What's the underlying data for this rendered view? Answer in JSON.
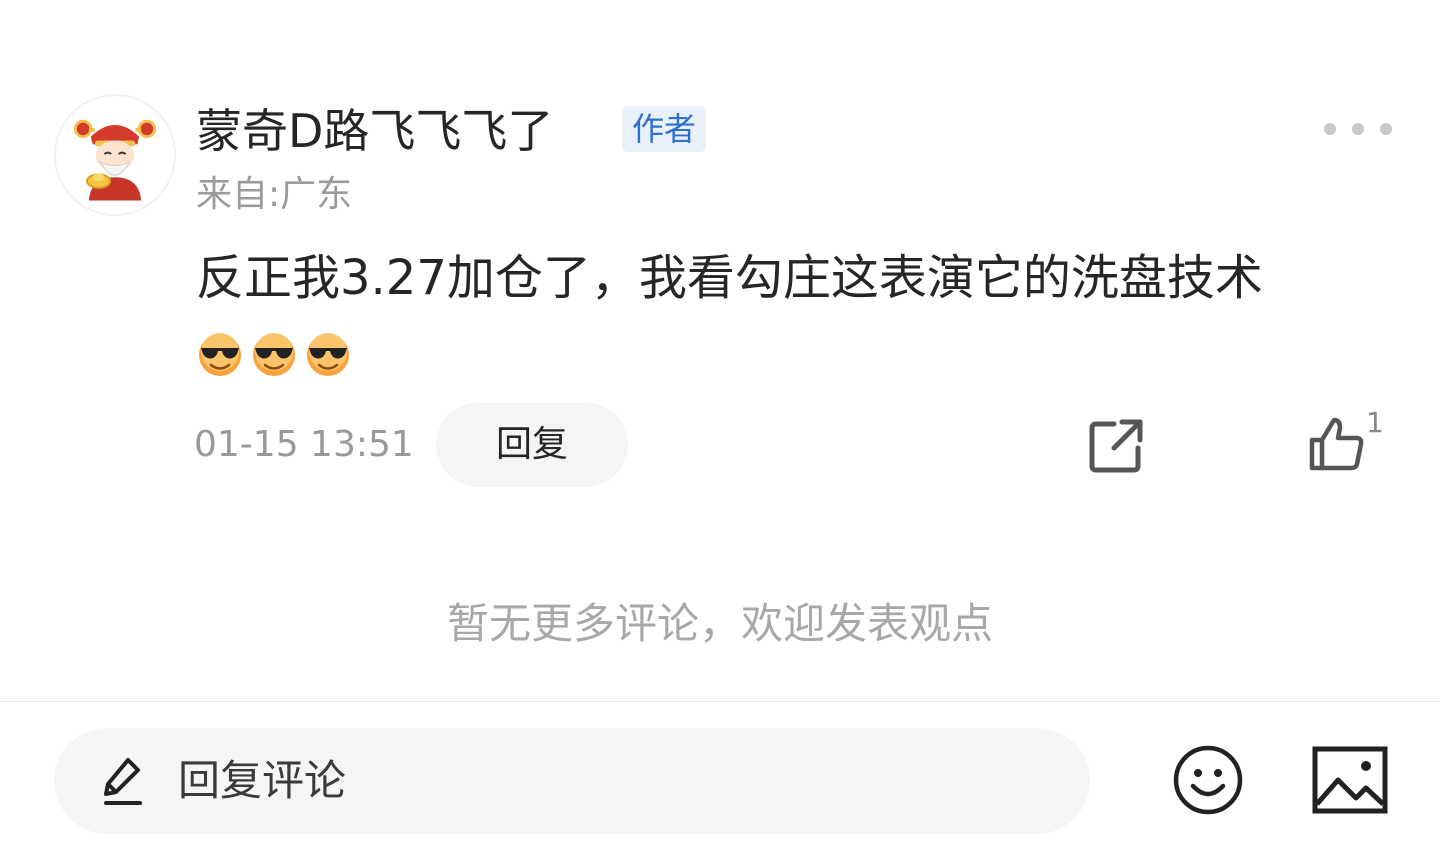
{
  "comment": {
    "username": "蒙奇D路飞飞飞了",
    "author_badge": "作者",
    "location": "来自:广东",
    "text": "反正我3.27加仓了，我看勾庄这表演它的洗盘技术",
    "emojis": [
      "sunglasses-emoji",
      "sunglasses-emoji",
      "sunglasses-emoji"
    ],
    "timestamp": "01-15 13:51",
    "reply_label": "回复",
    "like_count": "1"
  },
  "footer_notice": "暂无更多评论，欢迎发表观点",
  "bottom_bar": {
    "reply_placeholder": "回复评论"
  },
  "colors": {
    "author_badge_bg": "#e9f1fb",
    "author_badge_text": "#2f6fcf",
    "muted_text": "#999999",
    "pill_bg": "#f4f5f6"
  },
  "icons": [
    "avatar-image",
    "more-icon",
    "share-icon",
    "thumbs-up-icon",
    "pencil-icon",
    "emoji-icon",
    "image-icon"
  ]
}
